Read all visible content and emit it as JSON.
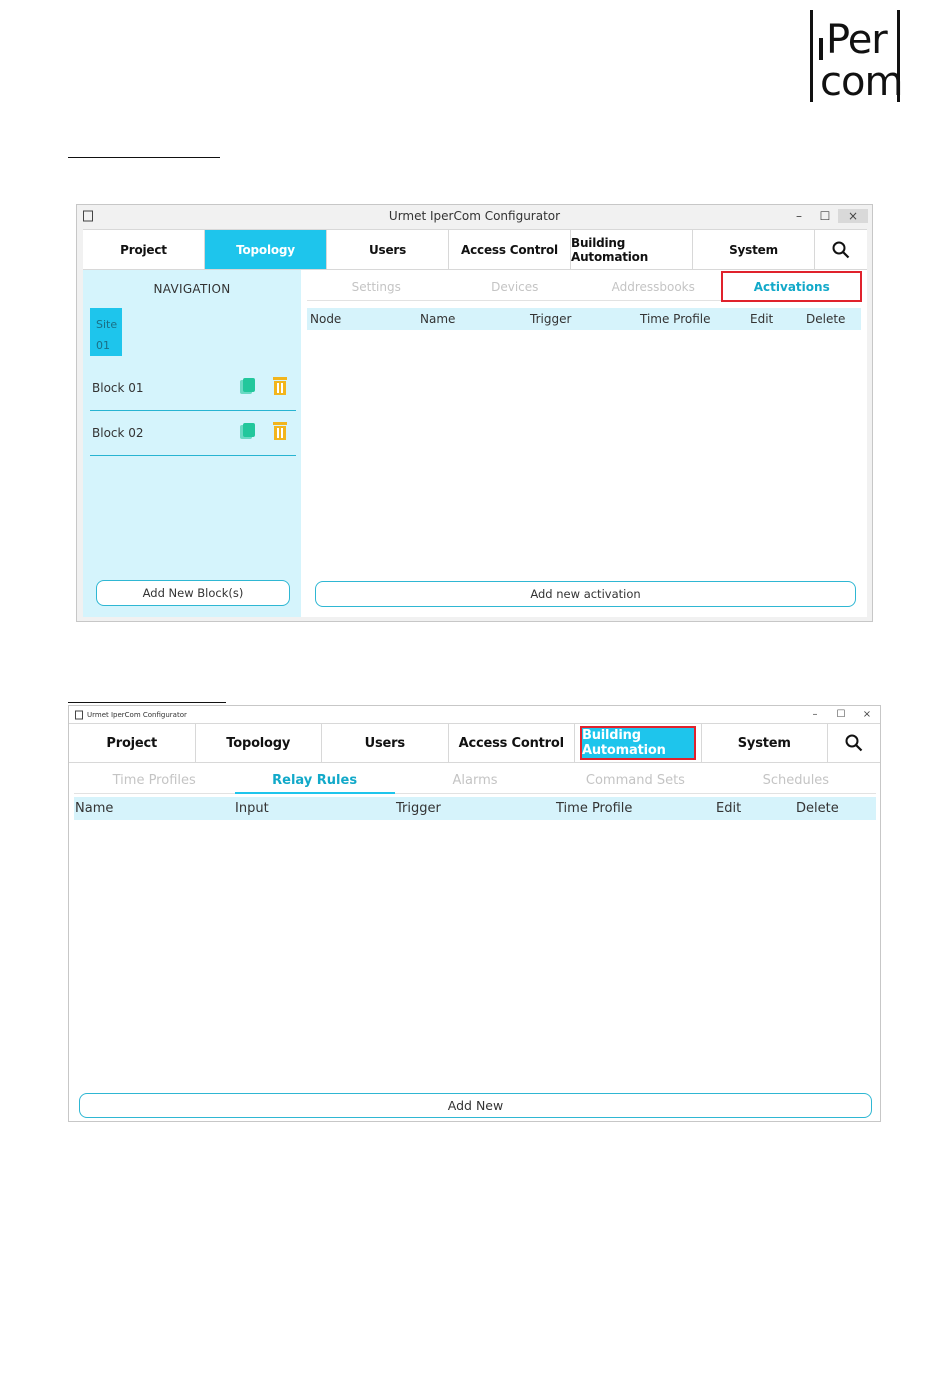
{
  "logo": {
    "line1": "Per",
    "line2": "com"
  },
  "window1": {
    "title": "Urmet IperCom Configurator",
    "controls": [
      "–",
      "☐",
      "×"
    ],
    "tabs": [
      "Project",
      "Topology",
      "Users",
      "Access Control",
      "Building Automation",
      "System"
    ],
    "active_tab": "Topology",
    "navigation": {
      "title": "NAVIGATION",
      "site_line1": "Site",
      "site_line2": "01",
      "blocks": [
        "Block 01",
        "Block 02"
      ],
      "add_button": "Add New Block(s)"
    },
    "subtabs": [
      "Settings",
      "Devices",
      "Addressbooks",
      "Activations"
    ],
    "active_subtab": "Activations",
    "columns": [
      "Node",
      "Name",
      "Trigger",
      "Time Profile",
      "Edit",
      "Delete"
    ],
    "add_button": "Add new activation"
  },
  "window2": {
    "title": "Urmet IperCom Configurator",
    "controls": [
      "–",
      "☐",
      "×"
    ],
    "tabs": [
      "Project",
      "Topology",
      "Users",
      "Access Control",
      "Building Automation",
      "System"
    ],
    "active_tab": "Building Automation",
    "subtabs": [
      "Time Profiles",
      "Relay Rules",
      "Alarms",
      "Command Sets",
      "Schedules"
    ],
    "active_subtab": "Relay Rules",
    "columns": [
      "Name",
      "Input",
      "Trigger",
      "Time Profile",
      "Edit",
      "Delete"
    ],
    "add_button": "Add New"
  },
  "colors": {
    "accent": "#1ec5ec",
    "highlight_box": "#e0222c",
    "copy_icon": "#22c79c",
    "trash_icon": "#f2b51c"
  }
}
